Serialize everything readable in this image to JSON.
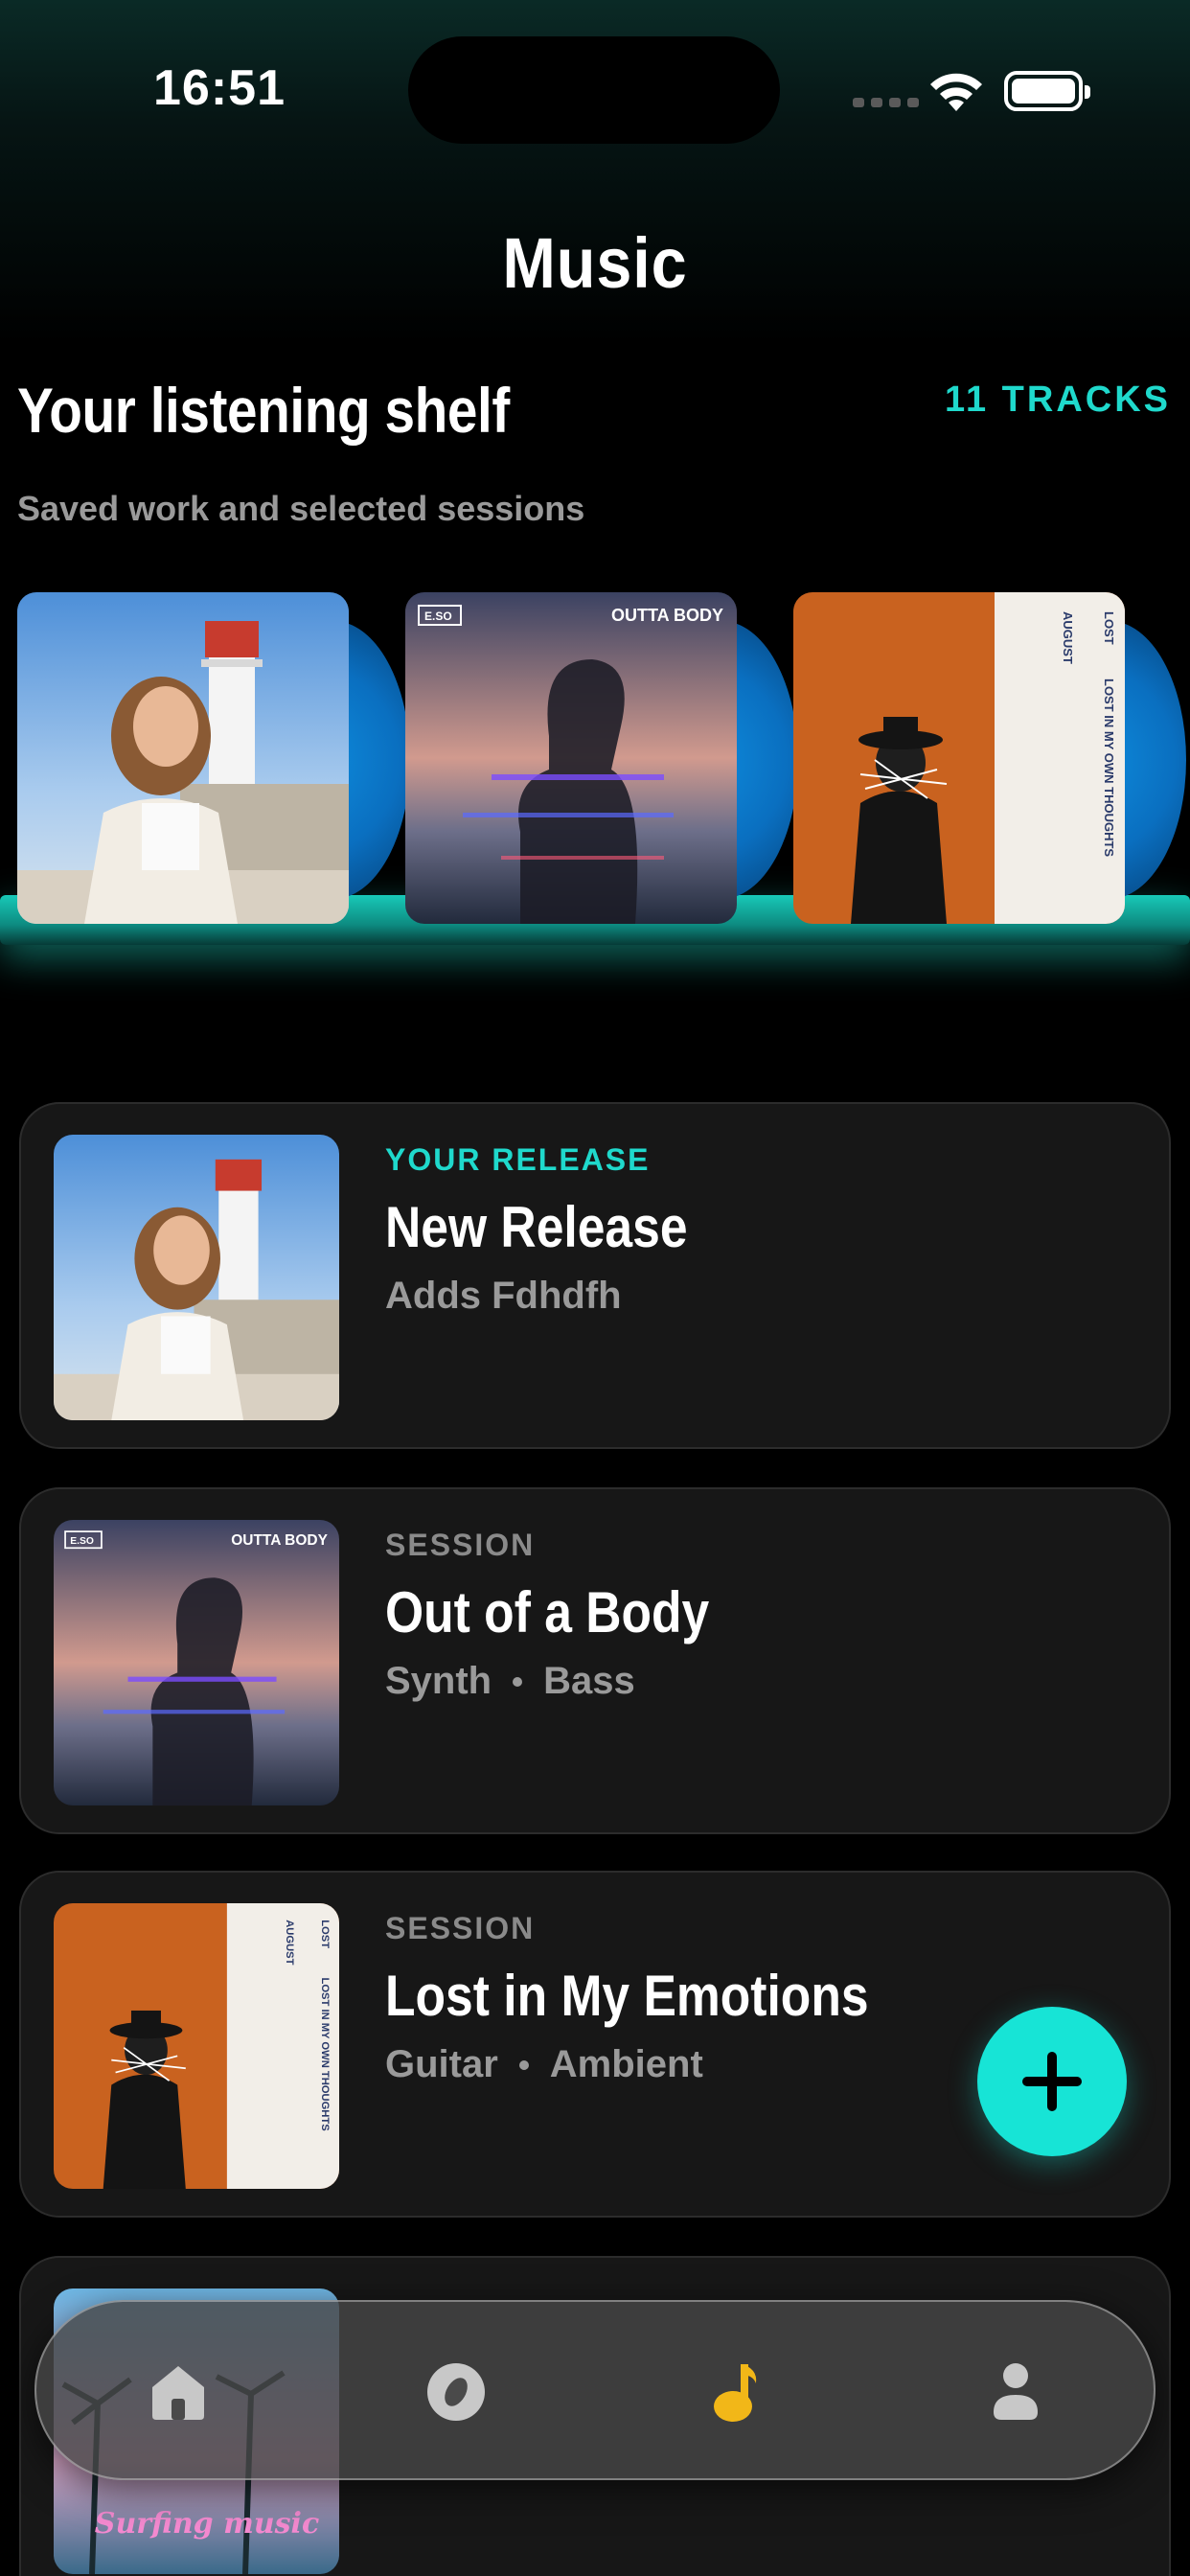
{
  "status_bar": {
    "time": "16:51"
  },
  "header": {
    "title": "Music"
  },
  "shelf": {
    "title": "Your listening shelf",
    "track_count": "11 TRACKS",
    "subtitle": "Saved work and selected sessions",
    "albums": [
      {
        "cover": "portrait-lighthouse-cover"
      },
      {
        "cover": "outta-body-cover",
        "cover_label_left": "E.SO",
        "cover_label_right": "OUTTA BODY"
      },
      {
        "cover": "lost-august-cover",
        "cover_text_top": "LOST",
        "cover_text_side": "LOST IN MY OWN THOUGHTS",
        "cover_text_august": "AUGUST"
      }
    ]
  },
  "tracks": [
    {
      "kicker": "YOUR RELEASE",
      "title": "New Release",
      "meta": [
        "Adds Fdhdfh"
      ],
      "accent": true
    },
    {
      "kicker": "SESSION",
      "title": "Out of a Body",
      "meta": [
        "Synth",
        "Bass"
      ],
      "accent": false
    },
    {
      "kicker": "SESSION",
      "title": "Lost in My Emotions",
      "meta": [
        "Guitar",
        "Ambient"
      ],
      "accent": false
    }
  ],
  "partial_card": {
    "art_text": "Surfing music"
  },
  "fab": {
    "icon": "plus-icon"
  },
  "bottom_nav": {
    "items": [
      {
        "icon": "home-icon",
        "active": false
      },
      {
        "icon": "disc-icon",
        "active": false
      },
      {
        "icon": "music-note-icon",
        "active": true
      },
      {
        "icon": "profile-icon",
        "active": false
      }
    ]
  },
  "colors": {
    "accent": "#1fd9cc",
    "fab": "#17e4d6",
    "nav_active": "#f2b718",
    "card_bg": "#171717"
  }
}
